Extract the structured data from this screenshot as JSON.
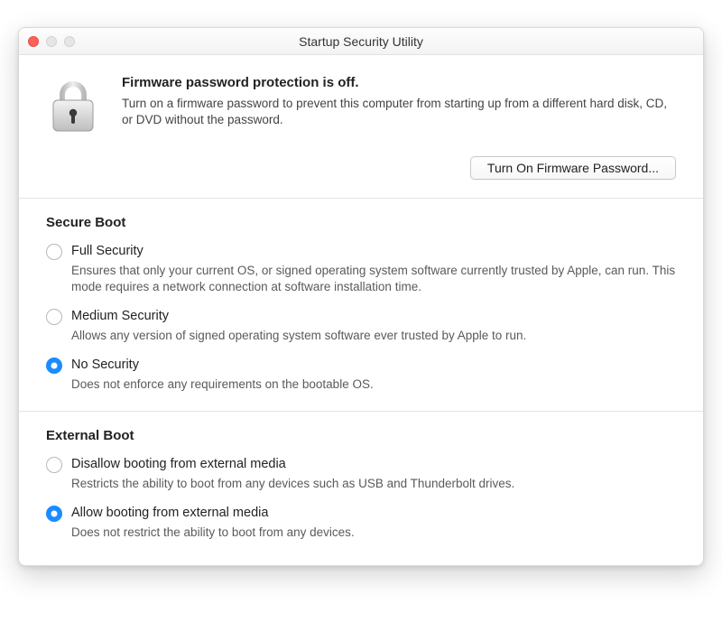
{
  "window": {
    "title": "Startup Security Utility"
  },
  "header": {
    "title": "Firmware password protection is off.",
    "description": "Turn on a firmware password to prevent this computer from starting up from a different hard disk, CD, or DVD without the password.",
    "button_label": "Turn On Firmware Password..."
  },
  "sections": {
    "secure_boot": {
      "title": "Secure Boot",
      "options": [
        {
          "label": "Full Security",
          "description": "Ensures that only your current OS, or signed operating system software currently trusted by Apple, can run. This mode requires a network connection at software installation time.",
          "selected": false
        },
        {
          "label": "Medium Security",
          "description": "Allows any version of signed operating system software ever trusted by Apple to run.",
          "selected": false
        },
        {
          "label": "No Security",
          "description": "Does not enforce any requirements on the bootable OS.",
          "selected": true
        }
      ]
    },
    "external_boot": {
      "title": "External Boot",
      "options": [
        {
          "label": "Disallow booting from external media",
          "description": "Restricts the ability to boot from any devices such as USB and Thunderbolt drives.",
          "selected": false
        },
        {
          "label": "Allow booting from external media",
          "description": "Does not restrict the ability to boot from any devices.",
          "selected": true
        }
      ]
    }
  }
}
